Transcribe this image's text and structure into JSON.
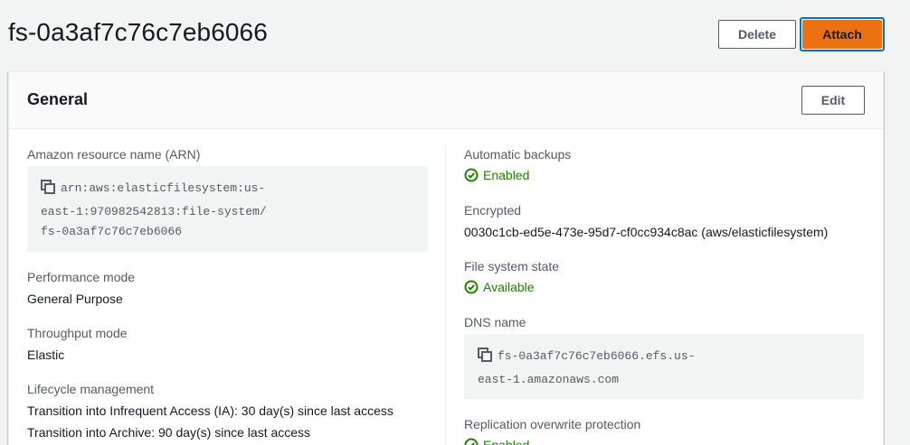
{
  "header": {
    "title": "fs-0a3af7c76c7eb6066",
    "delete_label": "Delete",
    "attach_label": "Attach"
  },
  "general": {
    "title": "General",
    "edit_label": "Edit",
    "arn": {
      "label": "Amazon resource name (ARN)",
      "line1": "arn:aws:elasticfilesystem:us-",
      "line2": "east-1:970982542813:file-system/",
      "line3": "fs-0a3af7c76c7eb6066"
    },
    "performance_mode": {
      "label": "Performance mode",
      "value": "General Purpose"
    },
    "throughput_mode": {
      "label": "Throughput mode",
      "value": "Elastic"
    },
    "lifecycle": {
      "label": "Lifecycle management",
      "ia": "Transition into Infrequent Access (IA): 30 day(s) since last access",
      "archive": "Transition into Archive: 90 day(s) since last access"
    },
    "automatic_backups": {
      "label": "Automatic backups",
      "value": "Enabled"
    },
    "encrypted": {
      "label": "Encrypted",
      "value": "0030c1cb-ed5e-473e-95d7-cf0cc934c8ac (aws/elasticfilesystem)"
    },
    "fs_state": {
      "label": "File system state",
      "value": "Available"
    },
    "dns": {
      "label": "DNS name",
      "line1": "fs-0a3af7c76c7eb6066.efs.us-",
      "line2": "east-1.amazonaws.com"
    },
    "replication": {
      "label": "Replication overwrite protection",
      "value": "Enabled"
    }
  },
  "colors": {
    "primary_button": "#ec7211",
    "focus_ring": "#0073bb",
    "status_success": "#1d8102",
    "page_bg": "#f2f3f3"
  },
  "icons": {
    "copy": "copy-icon",
    "status": "status-positive-icon"
  }
}
